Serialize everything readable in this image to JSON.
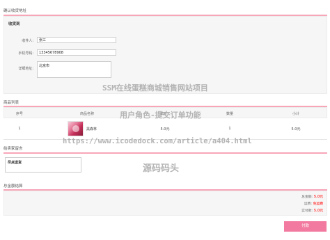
{
  "address": {
    "section_title": "确认收货地址",
    "subtitle": "收货到",
    "name_label": "收件人:",
    "name_value": "张三",
    "phone_label": "手机号码:",
    "phone_value": "13345678908",
    "detail_label": "详细地址:",
    "detail_value": "北京市"
  },
  "products": {
    "section_title": "商品列表",
    "columns": [
      "序号",
      "商品名称",
      "单价",
      "数量",
      "小计"
    ],
    "rows": [
      {
        "index": "1",
        "name": "黑森林",
        "price": "5.0元",
        "qty": "1",
        "subtotal": "5.0元"
      }
    ]
  },
  "message": {
    "section_title": "给卖家留言",
    "value": "尽点送货"
  },
  "summary": {
    "section_title": "总金额结算",
    "total_label": "总金额:",
    "total_value": "5.0元",
    "shipping_label": "运费:",
    "shipping_value": "免运费",
    "actual_label": "实付款:",
    "actual_value": "5.0元"
  },
  "pay_button": "付款",
  "watermarks": {
    "line1": "SSM在线蛋糕商城销售网站项目",
    "line2": "用户角色-提交订单功能",
    "line3": "https://www.icodedock.com/article/a404.html",
    "line4": "源码码头"
  }
}
